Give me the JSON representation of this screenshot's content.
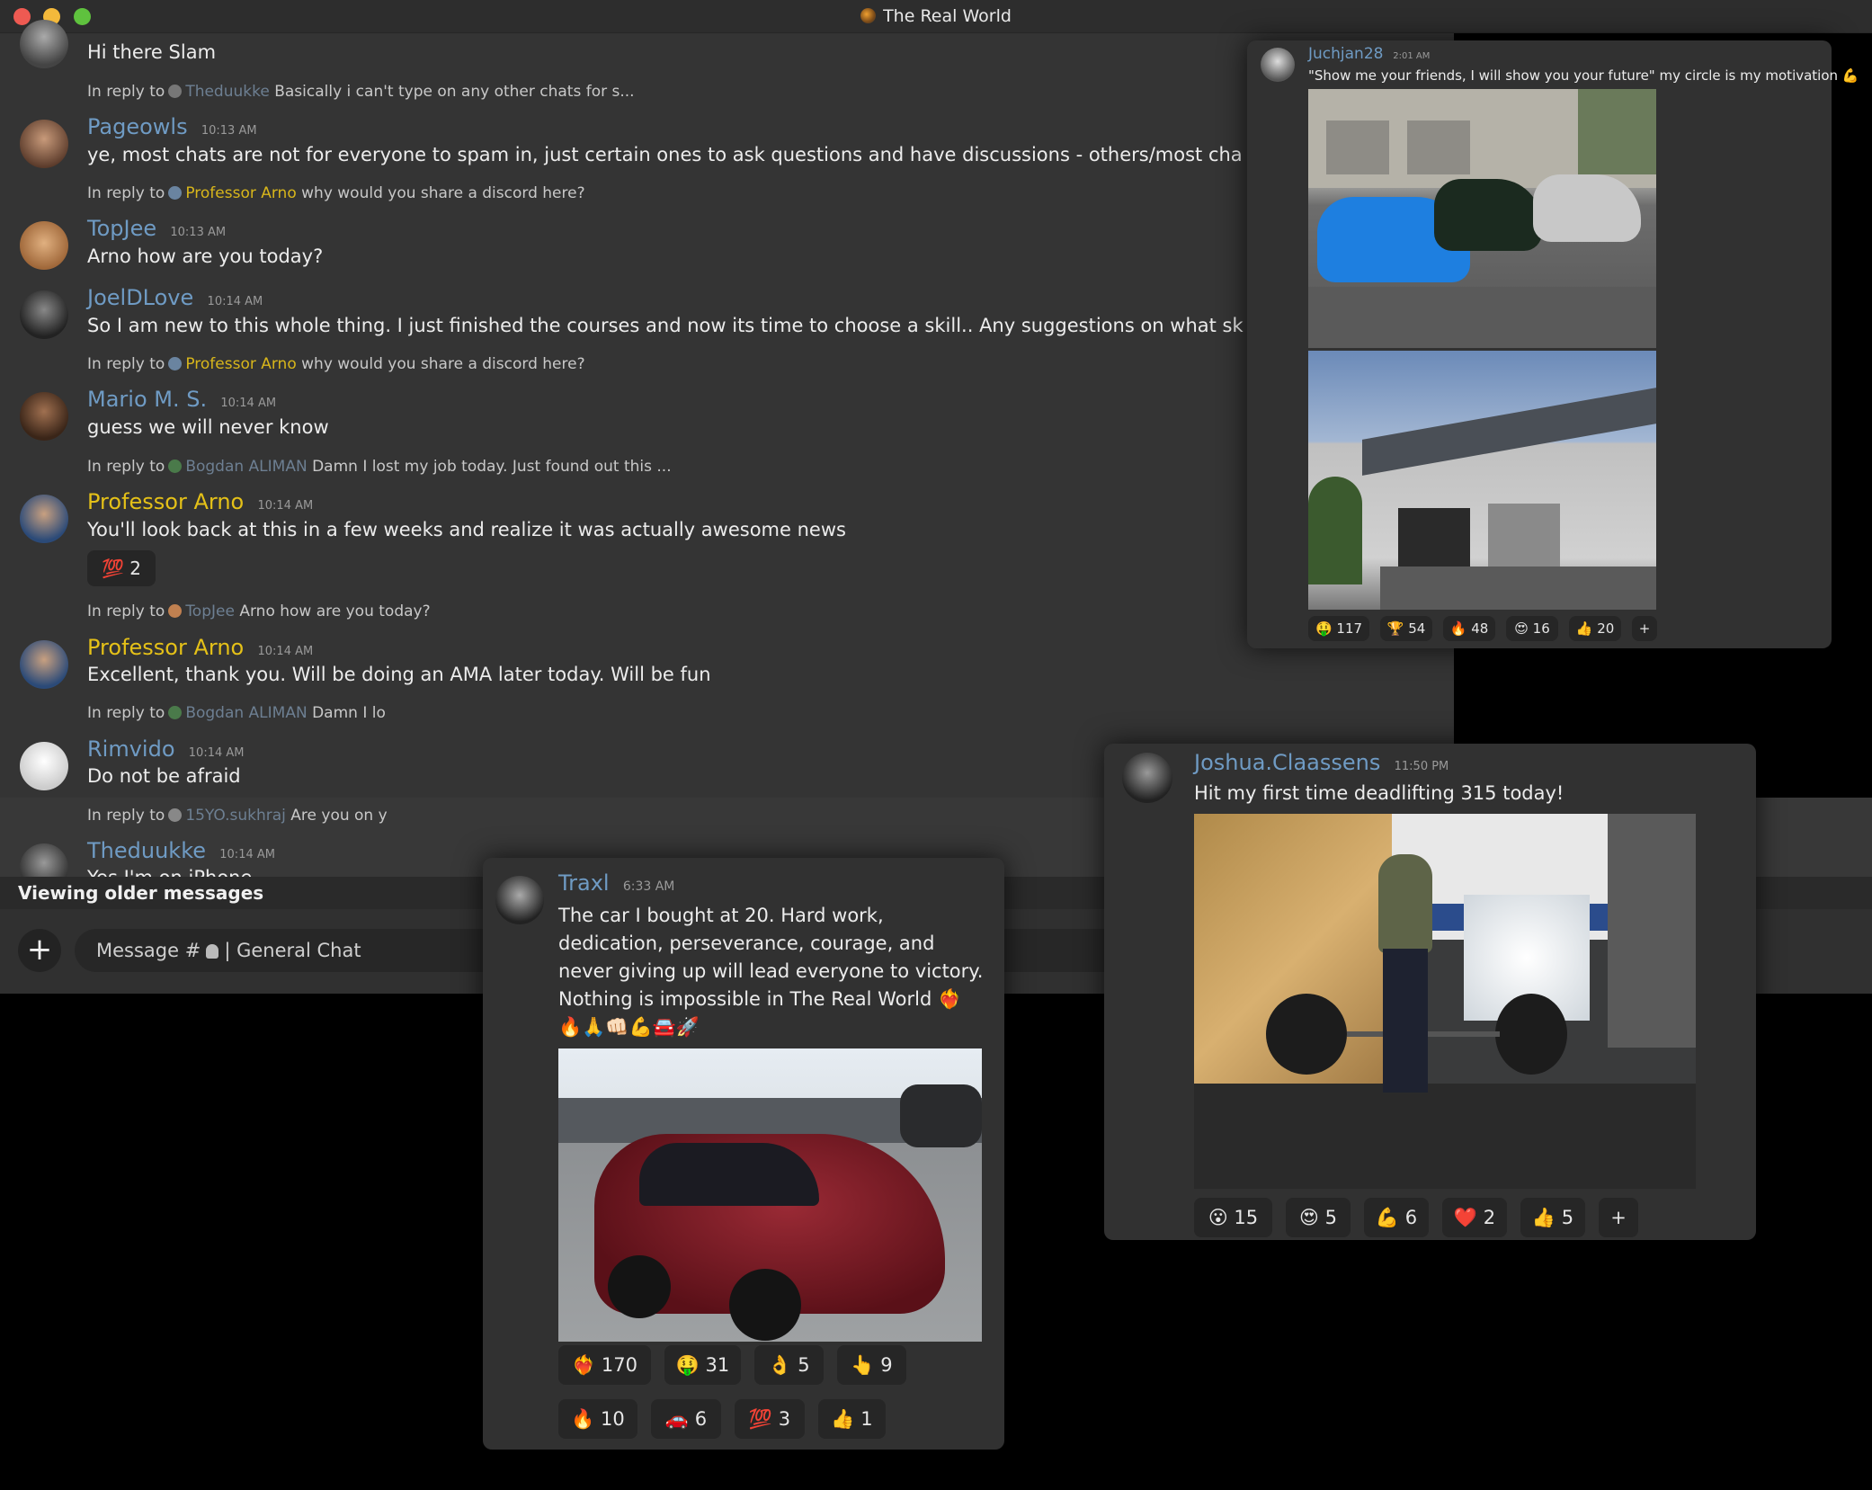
{
  "window": {
    "title": "The Real World"
  },
  "chat": {
    "top_body": "Hi there Slam",
    "reply_label": "In reply to",
    "messages": [
      {
        "reply": {
          "name": "Theduukke",
          "text": "Basically i can't type on any other chats for s..."
        },
        "user": "Pageowls",
        "time": "10:13 AM",
        "body": "ye, most chats are not for everyone to spam in, just certain ones to ask questions and have discussions - others/most cha"
      },
      {
        "reply": {
          "name": "Professor Arno",
          "text": "why would you share a discord here?"
        },
        "user": "TopJee",
        "time": "10:13 AM",
        "body": "Arno how are you today?"
      },
      {
        "user": "JoelDLove",
        "time": "10:14 AM",
        "body": "So I am new to this whole thing. I just finished the courses and now its time to choose a skill.. Any suggestions on what sk"
      },
      {
        "reply": {
          "name": "Professor Arno",
          "text": "why would you share a discord here?"
        },
        "user": "Mario M. S.",
        "time": "10:14 AM",
        "body": "guess we will never know"
      },
      {
        "reply": {
          "name": "Bogdan ALIMAN",
          "text": "Damn I lost my job today. Just found out this ..."
        },
        "user": "Professor Arno",
        "time": "10:14 AM",
        "body": "You'll look back at this in a few weeks and realize it was actually awesome news",
        "reaction": {
          "emoji": "💯",
          "count": "2"
        }
      },
      {
        "reply": {
          "name": "TopJee",
          "text": "Arno how are you today?"
        },
        "user": "Professor Arno",
        "time": "10:14 AM",
        "body": "Excellent, thank you. Will be doing an AMA later today. Will be fun"
      },
      {
        "reply": {
          "name": "Bogdan ALIMAN",
          "text": "Damn I lo"
        },
        "user": "Rimvido",
        "time": "10:14 AM",
        "body": "Do not be afraid"
      },
      {
        "reply": {
          "name": "15YO.sukhraj",
          "text": "Are you on y"
        },
        "user": "Theduukke",
        "time": "10:14 AM",
        "body": "Yes I'm on iPhone"
      }
    ],
    "viewing_banner": "Viewing older messages",
    "composer": {
      "plus": "+",
      "placeholder_prefix": "Message #",
      "channel": "| General Chat"
    }
  },
  "card_juchjan": {
    "user": "Juchjan28",
    "time": "2:01 AM",
    "body": "\"Show me your friends, I will show you your future\" my circle is my motivation 💪",
    "reactions": [
      {
        "emoji": "🤑",
        "count": "117"
      },
      {
        "emoji": "🏆",
        "count": "54"
      },
      {
        "emoji": "🔥",
        "count": "48"
      },
      {
        "emoji": "😍",
        "count": "16"
      },
      {
        "emoji": "👍",
        "count": "20"
      },
      {
        "emoji": "+",
        "count": ""
      }
    ]
  },
  "card_joshua": {
    "user": "Joshua.Claassens",
    "time": "11:50 PM",
    "body": "Hit my first time deadlifting 315 today!",
    "reactions": [
      {
        "emoji": "😮",
        "count": "15"
      },
      {
        "emoji": "😍",
        "count": "5"
      },
      {
        "emoji": "💪",
        "count": "6"
      },
      {
        "emoji": "❤️",
        "count": "2"
      },
      {
        "emoji": "👍",
        "count": "5"
      },
      {
        "emoji": "+",
        "count": ""
      }
    ]
  },
  "card_traxl": {
    "user": "Traxl",
    "time": "6:33 AM",
    "body_lines": [
      "The car I bought at 20. Hard work,",
      "dedication, perseverance, courage, and",
      "never giving up will lead everyone to victory.",
      "Nothing is impossible in The Real World ❤️‍🔥",
      "🔥🙏👊🏻💪🚘🚀"
    ],
    "reactions_row1": [
      {
        "emoji": "❤️‍🔥",
        "count": "170"
      },
      {
        "emoji": "🤑",
        "count": "31"
      },
      {
        "emoji": "👌",
        "count": "5"
      },
      {
        "emoji": "👆",
        "count": "9"
      }
    ],
    "reactions_row2": [
      {
        "emoji": "🔥",
        "count": "10"
      },
      {
        "emoji": "🚗",
        "count": "6"
      },
      {
        "emoji": "💯",
        "count": "3"
      },
      {
        "emoji": "👍",
        "count": "1"
      }
    ]
  }
}
